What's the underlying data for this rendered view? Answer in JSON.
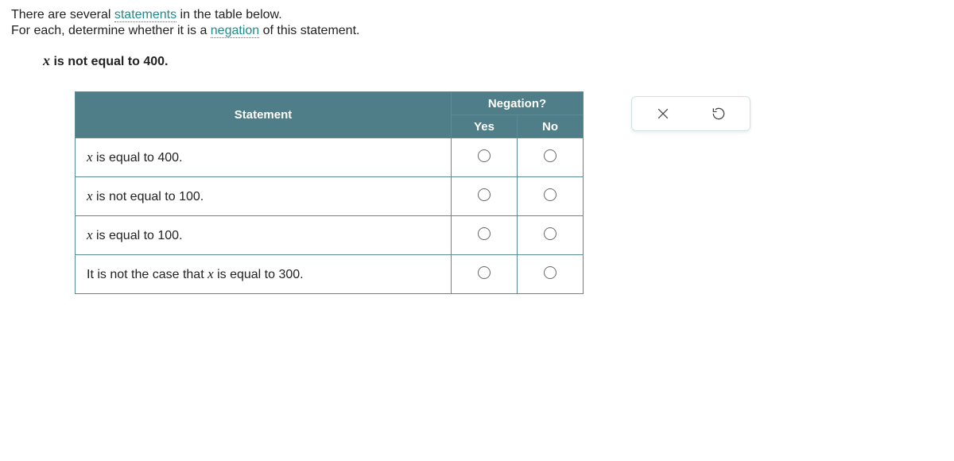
{
  "intro": {
    "part1": "There are several ",
    "term_statements": "statements",
    "part2": " in the table below.",
    "line2a": "For each, determine whether it is a ",
    "term_negation": "negation",
    "line2b": " of this statement."
  },
  "main_statement": {
    "var": "x",
    "rest": " is not equal to 400."
  },
  "table": {
    "header_statement": "Statement",
    "header_negation": "Negation?",
    "header_yes": "Yes",
    "header_no": "No",
    "rows": [
      {
        "var": "x",
        "text": " is equal to 400."
      },
      {
        "var": "x",
        "text": " is not equal to 100."
      },
      {
        "var": "x",
        "text": " is equal to 100."
      },
      {
        "prefix": "It is not the case that ",
        "var": "x",
        "text": " is equal to 300."
      }
    ]
  },
  "actions": {
    "close": "close",
    "reset": "reset"
  }
}
